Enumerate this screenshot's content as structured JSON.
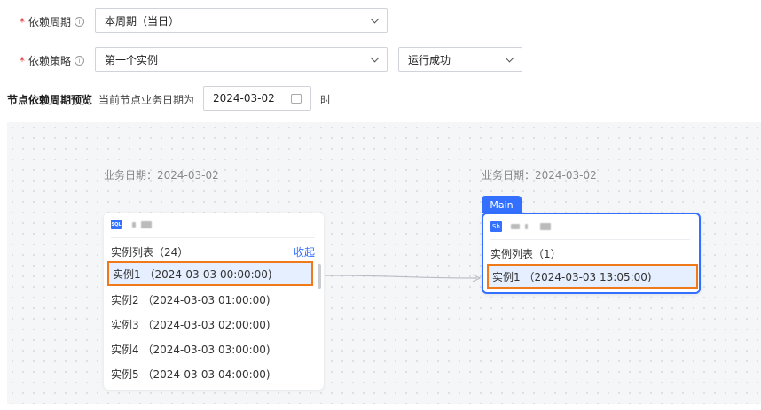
{
  "form": {
    "period": {
      "label": "依赖周期",
      "value": "本周期（当日）"
    },
    "strategy": {
      "label": "依赖策略",
      "value": "第一个实例",
      "status_value": "运行成功"
    },
    "info_glyph": "i"
  },
  "preview": {
    "title": "节点依赖周期预览",
    "desc": "当前节点业务日期为",
    "date": "2024-03-02",
    "suffix": "时"
  },
  "upstream": {
    "biz_date": "业务日期：2024-03-02",
    "icon_text": "SQL",
    "list_title": "实例列表（24）",
    "collapse": "收起",
    "instances": [
      "实例1 （2024-03-03 00:00:00)",
      "实例2 （2024-03-03 01:00:00)",
      "实例3 （2024-03-03 02:00:00)",
      "实例4 （2024-03-03 03:00:00)",
      "实例5 （2024-03-03 04:00:00)"
    ]
  },
  "main": {
    "tag": "Main",
    "biz_date": "业务日期：2024-03-02",
    "icon_text": "Sh",
    "list_title": "实例列表（1）",
    "instances": [
      "实例1 （2024-03-03 13:05:00)"
    ]
  },
  "icons": {
    "info": "info-circle-icon",
    "chevron": "chevron-down-icon",
    "calendar": "calendar-icon",
    "sql": "sql-file-icon",
    "shell": "shell-file-icon"
  },
  "colors": {
    "accent": "#3370ff",
    "highlight": "#f07a1a",
    "required": "#e03131"
  }
}
